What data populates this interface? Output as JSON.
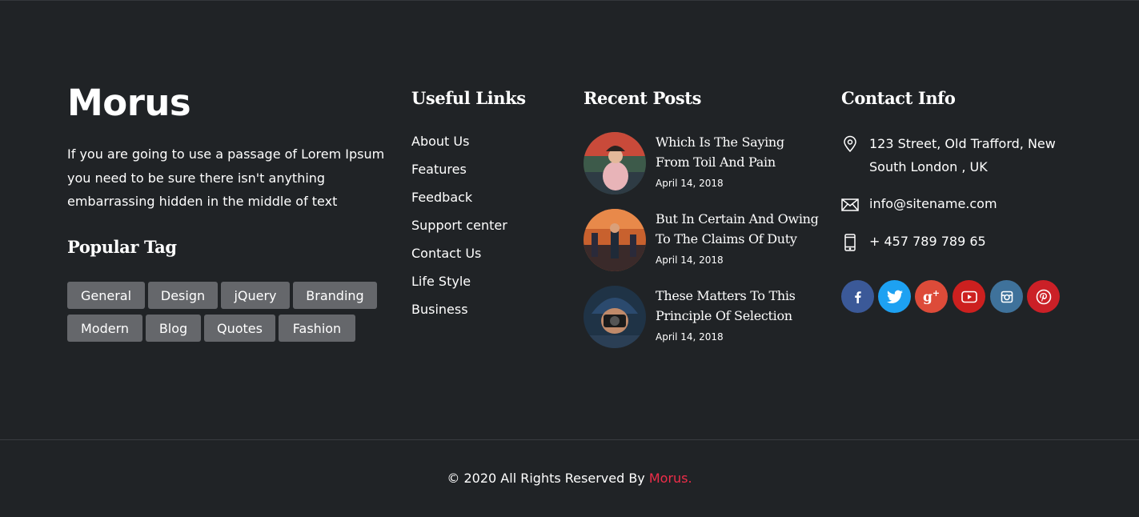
{
  "brand": {
    "logo": "Morus",
    "description": "If you are going to use a passage of Lorem Ipsum you need to be sure there isn't anything embarrassing hidden in the middle of text",
    "tags_heading": "Popular Tag",
    "tags": [
      "General",
      "Design",
      "jQuery",
      "Branding",
      "Modern",
      "Blog",
      "Quotes",
      "Fashion"
    ]
  },
  "links": {
    "heading": "Useful Links",
    "items": [
      "About Us",
      "Features",
      "Feedback",
      "Support center",
      "Contact Us",
      "Life Style",
      "Business"
    ]
  },
  "posts": {
    "heading": "Recent Posts",
    "items": [
      {
        "title": "Which Is The Saying From Toil And Pain",
        "date": "April 14, 2018"
      },
      {
        "title": "But In Certain And Owing To The Claims Of Duty",
        "date": "April 14, 2018"
      },
      {
        "title": "These Matters To This Principle Of Selection",
        "date": "April 14, 2018"
      }
    ]
  },
  "contact": {
    "heading": "Contact Info",
    "address": "123 Street, Old Trafford, New South London , UK",
    "email": "info@sitename.com",
    "phone": "+ 457 789 789 65",
    "social": [
      {
        "icon": "facebook-icon",
        "color": "#3b5998"
      },
      {
        "icon": "twitter-icon",
        "color": "#1da1f2"
      },
      {
        "icon": "google-plus-icon",
        "color": "#dd4b39"
      },
      {
        "icon": "youtube-icon",
        "color": "#cd201f"
      },
      {
        "icon": "instagram-icon",
        "color": "#3f729b"
      },
      {
        "icon": "pinterest-icon",
        "color": "#cb2027"
      }
    ]
  },
  "footer": {
    "copyright_prefix": "© 2020 All Rights Reserved By ",
    "brand_link": "Morus."
  },
  "colors": {
    "background": "#202326",
    "accent": "#ef2d49",
    "tag_bg": "#65676b"
  }
}
